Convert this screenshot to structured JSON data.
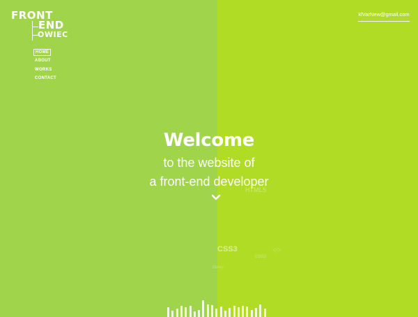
{
  "logo": {
    "line1": "FRONT",
    "line2": "END",
    "line3": "OWIEC"
  },
  "nav": {
    "items": [
      "HOME",
      "ABOUT",
      "WORKS",
      "CONTACT"
    ],
    "active": "HOME"
  },
  "contact": {
    "email": "klVarNew@gmail.com"
  },
  "hero": {
    "title": "Welcome",
    "line1": "to the website of",
    "line2": "a front-end developer",
    "scroll_icon": "chevron-down-icon"
  },
  "floating_words": {
    "html5": "HTML5",
    "css3": "CSS3",
    "css_small": "CSS3",
    "tag": "</>",
    "jquery": "jQuery"
  },
  "colors": {
    "left_bg": "#a0d54b",
    "right_bg": "#b0dc26",
    "text": "#ffffff"
  }
}
